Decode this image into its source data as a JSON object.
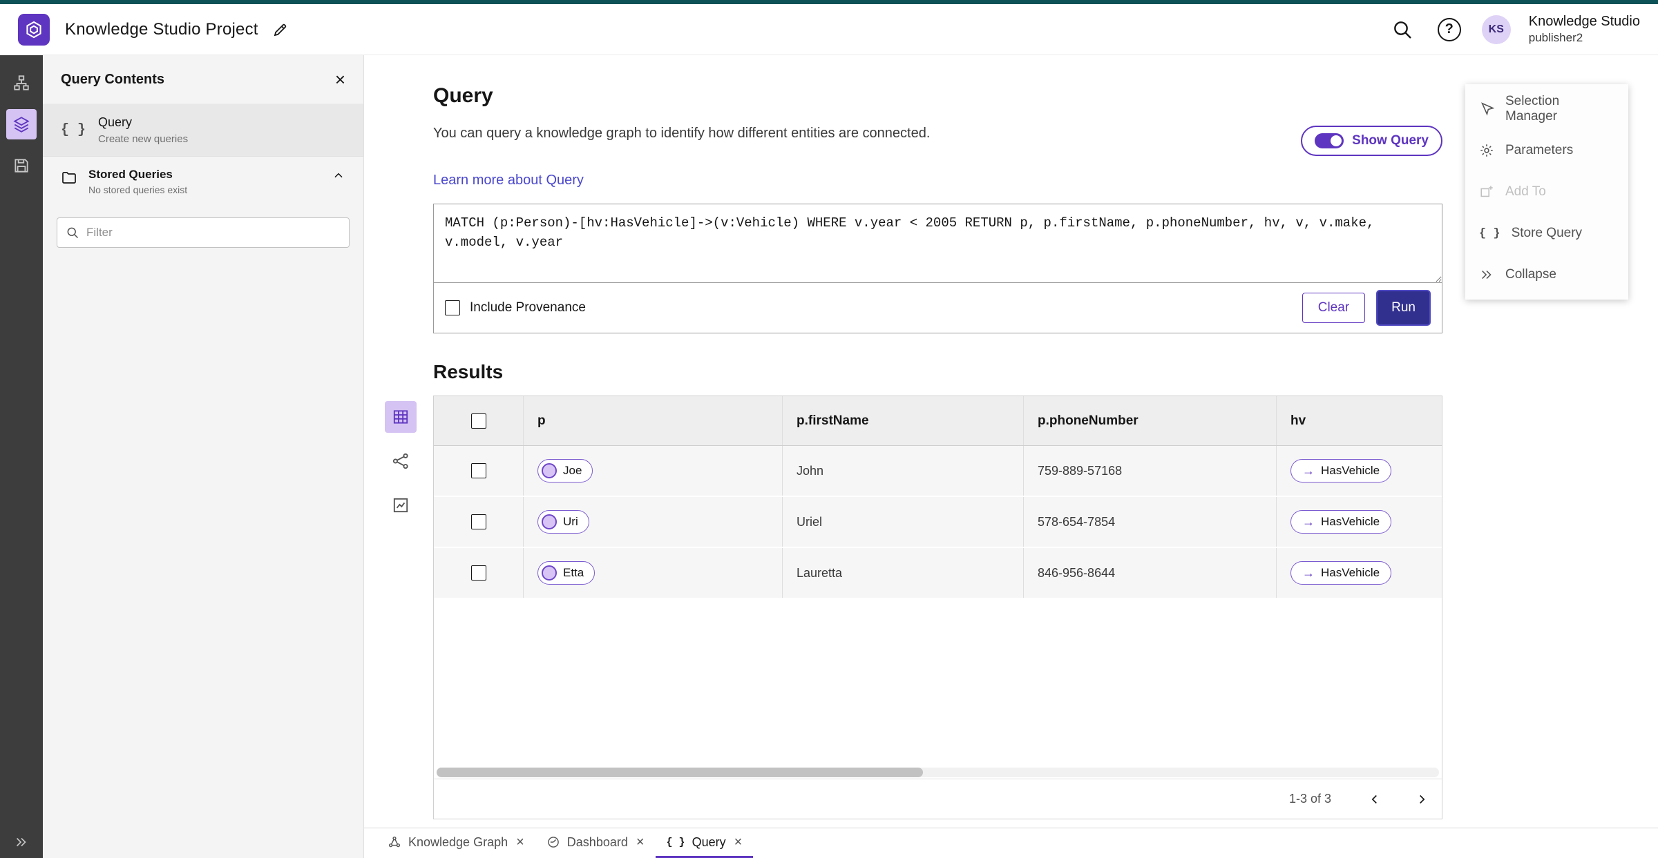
{
  "colors": {
    "accent": "#5e35c0",
    "accent_light": "#d8c5f6",
    "run_button": "#32308f",
    "top_strip": "#0d5257",
    "link": "#4a47cc",
    "rail_background": "#3d3d3d",
    "panel_background": "#f4f4f4"
  },
  "icons": {
    "braces_glyph": "{ }",
    "arrow_right": "→",
    "close_glyph": "×",
    "help_glyph": "?",
    "header_icons": [
      "search-icon",
      "help-icon"
    ],
    "rail_icons": [
      "hierarchy-icon",
      "layers-icon",
      "save-icon",
      "expand-icon"
    ],
    "view_icons": [
      "table-view-icon",
      "graph-view-icon",
      "chart-view-icon"
    ]
  },
  "header": {
    "project_title": "Knowledge Studio Project",
    "app_name": "Knowledge Studio",
    "user_name": "publisher2",
    "avatar_initials": "KS"
  },
  "panel": {
    "title": "Query Contents",
    "query_item": {
      "label": "Query",
      "description": "Create new queries"
    },
    "stored": {
      "label": "Stored Queries",
      "empty": "No stored queries exist"
    },
    "filter_placeholder": "Filter"
  },
  "query": {
    "title": "Query",
    "description": "You can query a knowledge graph to identify how different entities are connected.",
    "learn_more": "Learn more about Query",
    "show_query": "Show Query",
    "text": "MATCH (p:Person)-[hv:HasVehicle]->(v:Vehicle) WHERE v.year < 2005 RETURN p, p.firstName, p.phoneNumber, hv, v, v.make, v.model, v.year",
    "include_provenance": "Include Provenance",
    "clear": "Clear",
    "run": "Run"
  },
  "results": {
    "title": "Results",
    "columns": [
      "p",
      "p.firstName",
      "p.phoneNumber",
      "hv"
    ],
    "rows": [
      {
        "p": "Joe",
        "firstName": "John",
        "phone": "759-889-57168",
        "hv": "HasVehicle"
      },
      {
        "p": "Uri",
        "firstName": "Uriel",
        "phone": "578-654-7854",
        "hv": "HasVehicle"
      },
      {
        "p": "Etta",
        "firstName": "Lauretta",
        "phone": "846-956-8644",
        "hv": "HasVehicle"
      }
    ],
    "pagination": "1-3 of 3"
  },
  "menu": {
    "items": [
      {
        "label": "Selection Manager",
        "icon": "selection-manager-icon",
        "disabled": false
      },
      {
        "label": "Parameters",
        "icon": "gear-icon",
        "disabled": false
      },
      {
        "label": "Add To",
        "icon": "add-to-icon",
        "disabled": true
      },
      {
        "label": "Store Query",
        "icon": "braces-icon",
        "disabled": false
      },
      {
        "label": "Collapse",
        "icon": "collapse-icon",
        "disabled": false
      }
    ]
  },
  "tabs": [
    {
      "label": "Knowledge Graph",
      "icon": "graph-icon",
      "active": false
    },
    {
      "label": "Dashboard",
      "icon": "dashboard-icon",
      "active": false
    },
    {
      "label": "Query",
      "icon": "braces-icon",
      "active": true
    }
  ]
}
